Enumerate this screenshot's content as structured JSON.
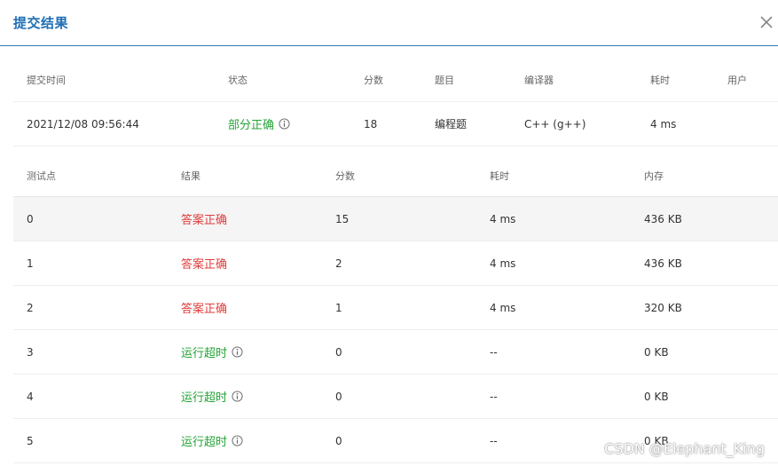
{
  "modal": {
    "title": "提交结果",
    "close_icon": "close-icon"
  },
  "submission": {
    "headers": [
      "提交时间",
      "状态",
      "分数",
      "题目",
      "编译器",
      "耗时",
      "用户"
    ],
    "row": {
      "time": "2021/12/08 09:56:44",
      "status": "部分正确",
      "score": "18",
      "problem": "编程题",
      "compiler": "C++ (g++)",
      "duration": "4 ms",
      "user": ""
    }
  },
  "tests": {
    "headers": [
      "测试点",
      "结果",
      "分数",
      "耗时",
      "内存"
    ],
    "rows": [
      {
        "id": "0",
        "result": "答案正确",
        "result_type": "accepted",
        "score": "15",
        "time": "4 ms",
        "memory": "436 KB"
      },
      {
        "id": "1",
        "result": "答案正确",
        "result_type": "accepted",
        "score": "2",
        "time": "4 ms",
        "memory": "436 KB"
      },
      {
        "id": "2",
        "result": "答案正确",
        "result_type": "accepted",
        "score": "1",
        "time": "4 ms",
        "memory": "320 KB"
      },
      {
        "id": "3",
        "result": "运行超时",
        "result_type": "timeout",
        "score": "0",
        "time": "--",
        "memory": "0 KB"
      },
      {
        "id": "4",
        "result": "运行超时",
        "result_type": "timeout",
        "score": "0",
        "time": "--",
        "memory": "0 KB"
      },
      {
        "id": "5",
        "result": "运行超时",
        "result_type": "timeout",
        "score": "0",
        "time": "--",
        "memory": "0 KB"
      }
    ]
  },
  "colors": {
    "title": "#1f6fb5",
    "partial": "#24a336",
    "accepted": "#e03c3c",
    "timeout": "#24a336"
  },
  "watermark": "CSDN @Elephant_King"
}
